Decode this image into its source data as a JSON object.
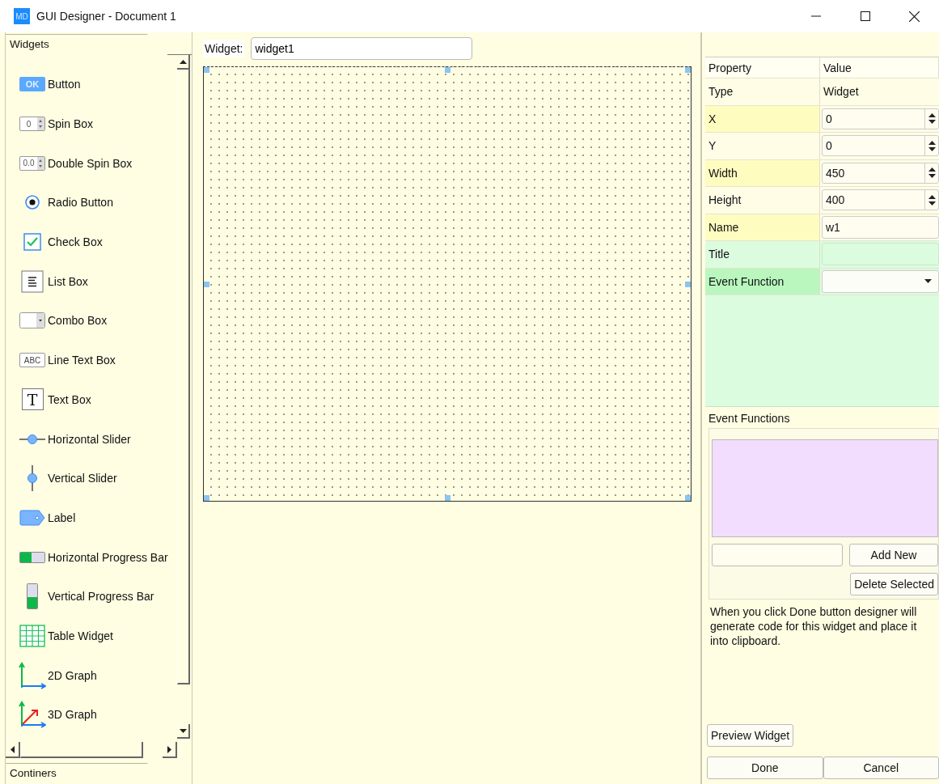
{
  "window": {
    "title": "GUI Designer - Document 1",
    "icon_text": "MD"
  },
  "widgets_tab": {
    "label": "Widgets"
  },
  "palette": [
    {
      "label": "Button",
      "kind": "button",
      "icon_text": "OK"
    },
    {
      "label": "Spin Box",
      "kind": "spin",
      "icon_text": "0"
    },
    {
      "label": "Double Spin Box",
      "kind": "spin",
      "icon_text": "0.0"
    },
    {
      "label": "Radio Button",
      "kind": "radio"
    },
    {
      "label": "Check Box",
      "kind": "check"
    },
    {
      "label": "List Box",
      "kind": "list"
    },
    {
      "label": "Combo Box",
      "kind": "combo"
    },
    {
      "label": "Line Text Box",
      "kind": "lineedit",
      "icon_text": "ABC"
    },
    {
      "label": "Text Box",
      "kind": "textbox",
      "icon_text": "T"
    },
    {
      "label": "Horizontal Slider",
      "kind": "hslider"
    },
    {
      "label": "Vertical Slider",
      "kind": "vslider"
    },
    {
      "label": "Label",
      "kind": "label"
    },
    {
      "label": "Horizontal Progress Bar",
      "kind": "hprogress"
    },
    {
      "label": "Vertical Progress Bar",
      "kind": "vprogress"
    },
    {
      "label": "Table Widget",
      "kind": "table"
    },
    {
      "label": "2D Graph",
      "kind": "graph2d"
    },
    {
      "label": "3D Graph",
      "kind": "graph3d"
    }
  ],
  "containers_tab": {
    "label": "Continers"
  },
  "editor": {
    "label": "Widget:",
    "value": "widget1"
  },
  "properties": {
    "columns": [
      "Property",
      "Value"
    ],
    "rows": [
      {
        "name": "Type",
        "value": "Widget",
        "kind": "text"
      },
      {
        "name": "X",
        "value": "0",
        "kind": "spin"
      },
      {
        "name": "Y",
        "value": "0",
        "kind": "spin"
      },
      {
        "name": "Width",
        "value": "450",
        "kind": "spin"
      },
      {
        "name": "Height",
        "value": "400",
        "kind": "spin"
      },
      {
        "name": "Name",
        "value": "w1",
        "kind": "field"
      }
    ]
  },
  "event_properties": {
    "rows": [
      {
        "name": "Title",
        "kind": "field"
      },
      {
        "name": "Event Function",
        "kind": "combo"
      }
    ]
  },
  "event_functions": {
    "title": "Event Functions",
    "add_button": "Add New",
    "delete_button": "Delete Selected"
  },
  "note": "When you click Done button designer will generate code for this widget and place it into clipboard.",
  "preview_button": "Preview Widget",
  "buttons": [
    "Done",
    "Cancel"
  ]
}
